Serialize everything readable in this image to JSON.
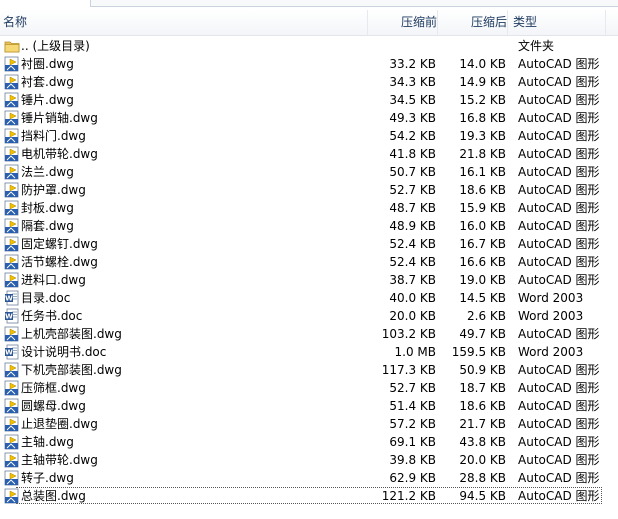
{
  "header": {
    "name": "名称",
    "original": "压缩前",
    "compressed": "压缩后",
    "type": "类型"
  },
  "files": [
    {
      "name": ".. (上级目录)",
      "original": "",
      "compressed": "",
      "type": "文件夹",
      "icon": "folder"
    },
    {
      "name": "衬圈.dwg",
      "original": "33.2 KB",
      "compressed": "14.0 KB",
      "type": "AutoCAD 图形",
      "icon": "dwg"
    },
    {
      "name": "衬套.dwg",
      "original": "34.3 KB",
      "compressed": "14.9 KB",
      "type": "AutoCAD 图形",
      "icon": "dwg"
    },
    {
      "name": "锤片.dwg",
      "original": "34.5 KB",
      "compressed": "15.2 KB",
      "type": "AutoCAD 图形",
      "icon": "dwg"
    },
    {
      "name": "锤片销轴.dwg",
      "original": "49.3 KB",
      "compressed": "16.8 KB",
      "type": "AutoCAD 图形",
      "icon": "dwg"
    },
    {
      "name": "挡料门.dwg",
      "original": "54.2 KB",
      "compressed": "19.3 KB",
      "type": "AutoCAD 图形",
      "icon": "dwg"
    },
    {
      "name": "电机带轮.dwg",
      "original": "41.8 KB",
      "compressed": "21.8 KB",
      "type": "AutoCAD 图形",
      "icon": "dwg"
    },
    {
      "name": "法兰.dwg",
      "original": "50.7 KB",
      "compressed": "16.1 KB",
      "type": "AutoCAD 图形",
      "icon": "dwg"
    },
    {
      "name": "防护罩.dwg",
      "original": "52.7 KB",
      "compressed": "18.6 KB",
      "type": "AutoCAD 图形",
      "icon": "dwg"
    },
    {
      "name": "封板.dwg",
      "original": "48.7 KB",
      "compressed": "15.9 KB",
      "type": "AutoCAD 图形",
      "icon": "dwg"
    },
    {
      "name": "隔套.dwg",
      "original": "48.9 KB",
      "compressed": "16.0 KB",
      "type": "AutoCAD 图形",
      "icon": "dwg"
    },
    {
      "name": "固定螺钉.dwg",
      "original": "52.4 KB",
      "compressed": "16.7 KB",
      "type": "AutoCAD 图形",
      "icon": "dwg"
    },
    {
      "name": "活节螺栓.dwg",
      "original": "52.4 KB",
      "compressed": "16.6 KB",
      "type": "AutoCAD 图形",
      "icon": "dwg"
    },
    {
      "name": "进料口.dwg",
      "original": "38.7 KB",
      "compressed": "19.0 KB",
      "type": "AutoCAD 图形",
      "icon": "dwg"
    },
    {
      "name": "目录.doc",
      "original": "40.0 KB",
      "compressed": "14.5 KB",
      "type": "Word 2003",
      "icon": "doc"
    },
    {
      "name": "任务书.doc",
      "original": "20.0 KB",
      "compressed": "2.6 KB",
      "type": "Word 2003",
      "icon": "doc"
    },
    {
      "name": "上机壳部装图.dwg",
      "original": "103.2 KB",
      "compressed": "49.7 KB",
      "type": "AutoCAD 图形",
      "icon": "dwg"
    },
    {
      "name": "设计说明书.doc",
      "original": "1.0 MB",
      "compressed": "159.5 KB",
      "type": "Word 2003",
      "icon": "doc"
    },
    {
      "name": "下机壳部装图.dwg",
      "original": "117.3 KB",
      "compressed": "50.9 KB",
      "type": "AutoCAD 图形",
      "icon": "dwg"
    },
    {
      "name": "压筛框.dwg",
      "original": "52.7 KB",
      "compressed": "18.7 KB",
      "type": "AutoCAD 图形",
      "icon": "dwg"
    },
    {
      "name": "圆螺母.dwg",
      "original": "51.4 KB",
      "compressed": "18.6 KB",
      "type": "AutoCAD 图形",
      "icon": "dwg"
    },
    {
      "name": "止退垫圈.dwg",
      "original": "57.2 KB",
      "compressed": "21.7 KB",
      "type": "AutoCAD 图形",
      "icon": "dwg"
    },
    {
      "name": "主轴.dwg",
      "original": "69.1 KB",
      "compressed": "43.8 KB",
      "type": "AutoCAD 图形",
      "icon": "dwg"
    },
    {
      "name": "主轴带轮.dwg",
      "original": "39.8 KB",
      "compressed": "20.0 KB",
      "type": "AutoCAD 图形",
      "icon": "dwg"
    },
    {
      "name": "转子.dwg",
      "original": "62.9 KB",
      "compressed": "28.8 KB",
      "type": "AutoCAD 图形",
      "icon": "dwg"
    },
    {
      "name": "总装图.dwg",
      "original": "121.2 KB",
      "compressed": "94.5 KB",
      "type": "AutoCAD 图形",
      "icon": "dwg",
      "selected": true
    }
  ]
}
